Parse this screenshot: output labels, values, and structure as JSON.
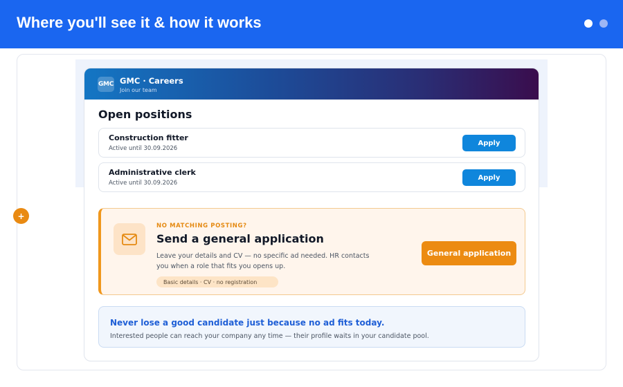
{
  "slide": {
    "title": "Where you'll see it & how it works"
  },
  "careers_page": {
    "logo_text": "GMC",
    "brand_name": "GMC · Careers",
    "brand_tagline": "Join our team",
    "section_title": "Open positions",
    "jobs": [
      {
        "title": "Construction fitter",
        "status": "Active until 30.09.2026",
        "action_label": "Apply"
      },
      {
        "title": "Administrative clerk",
        "status": "Active until 30.09.2026",
        "action_label": "Apply"
      }
    ],
    "general_application": {
      "badge": "+",
      "eyebrow": "NO MATCHING POSTING?",
      "heading": "Send a general application",
      "description": "Leave your details and CV — no specific ad needed. HR contacts you when a role that fits you opens up.",
      "pill": "Basic details · CV · no registration",
      "button_label": "General application",
      "icon": "mail-icon"
    },
    "note": {
      "title": "Never lose a good candidate just because no ad fits today.",
      "body": "Interested people can reach your company any time — their profile waits in your candidate pool."
    }
  },
  "colors": {
    "header_blue": "#1a66f0",
    "apply_blue": "#0f86dc",
    "accent_orange": "#ec8b12",
    "note_blue": "#1f5fd6"
  }
}
